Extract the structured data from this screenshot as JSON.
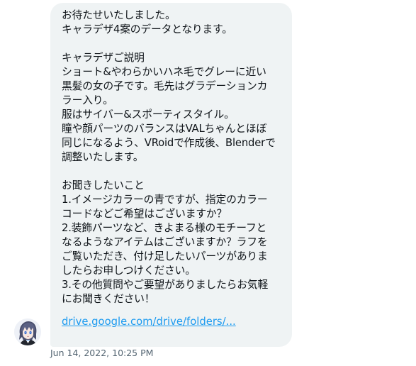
{
  "message": {
    "lines": [
      "お待たせいたしました。",
      "キャラデザ4案のデータとなります。",
      "",
      "キャラデザご説明",
      "ショート&やわらかいハネ毛でグレーに近い",
      "黒髪の女の子です。毛先はグラデーションカ",
      "ラー入り。",
      "服はサイバー&スポーティスタイル。",
      "瞳や顔パーツのバランスはVALちゃんとほぼ",
      "同じになるよう、VRoidで作成後、Blenderで",
      "調整いたします。",
      "",
      "お聞きしたいこと",
      "1.イメージカラーの青ですが、指定のカラー",
      "コードなどご希望はございますか？",
      "2.装飾パーツなど、きよまる様のモチーフと",
      "なるようなアイテムはございますか？ラフを",
      "ご覧いただき、付け足したいパーツがありま",
      "したらお申しつけください。",
      "3.その他質問やご要望がありましたらお気軽",
      "にお聞きください！"
    ],
    "link": "drive.google.com/drive/folders/...",
    "timestamp": "Jun 14, 2022, 10:25 PM"
  },
  "colors": {
    "bubble_bg": "#eff3f4",
    "text": "#0f1419",
    "link": "#1d9bf0",
    "timestamp": "#536471"
  },
  "icons": {
    "avatar": "sender-avatar-anime-girl"
  }
}
